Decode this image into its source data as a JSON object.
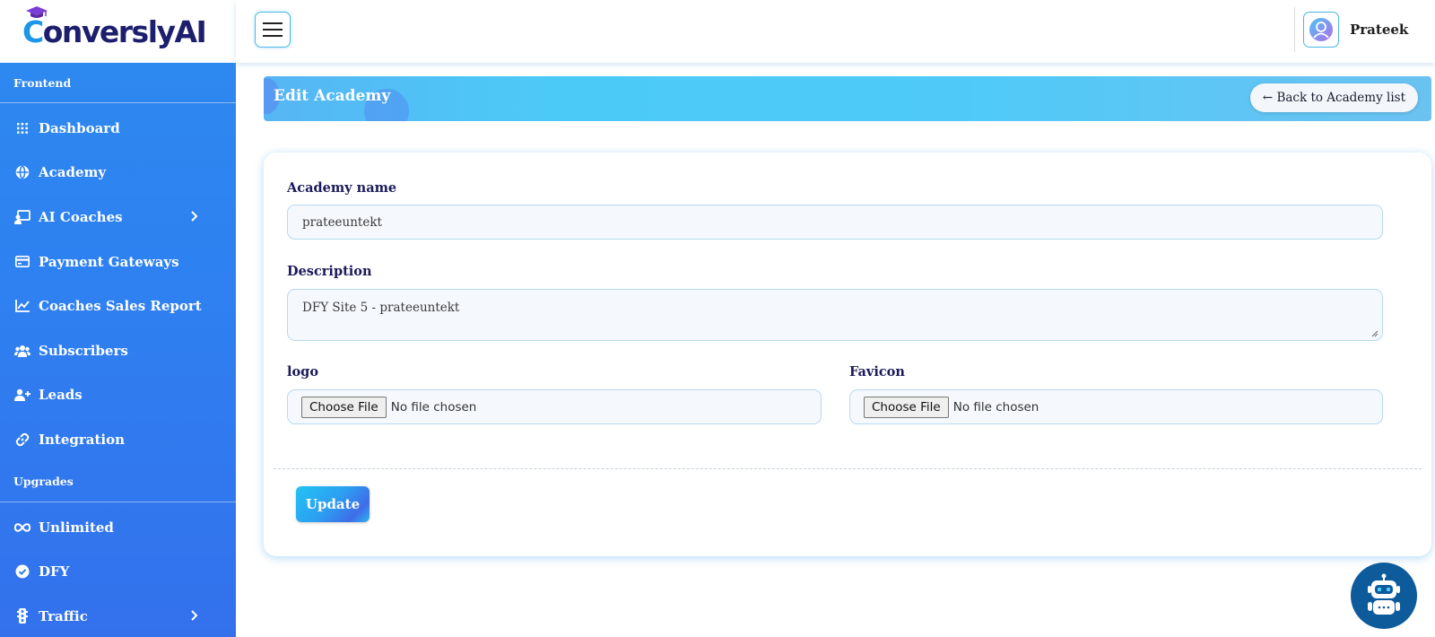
{
  "brand": {
    "logo_prefix": "C",
    "logo_text": "onverslyAI"
  },
  "sidebar": {
    "section1": "Frontend",
    "items": [
      {
        "label": "Dashboard",
        "icon": "grid-icon"
      },
      {
        "label": "Academy",
        "icon": "globe-icon"
      },
      {
        "label": "AI Coaches",
        "icon": "chalkboard-icon",
        "has_submenu": true
      },
      {
        "label": "Payment Gateways",
        "icon": "credit-card-icon"
      },
      {
        "label": "Coaches Sales Report",
        "icon": "chart-line-icon"
      },
      {
        "label": "Subscribers",
        "icon": "users-icon"
      },
      {
        "label": "Leads",
        "icon": "user-plus-icon"
      },
      {
        "label": "Integration",
        "icon": "link-icon"
      }
    ],
    "section2": "Upgrades",
    "upgrade_items": [
      {
        "label": "Unlimited",
        "icon": "infinity-icon"
      },
      {
        "label": "DFY",
        "icon": "check-circle-icon"
      },
      {
        "label": "Traffic",
        "icon": "traffic-light-icon",
        "has_submenu": true
      }
    ]
  },
  "topbar": {
    "user_name": "Prateek"
  },
  "header": {
    "title": "Edit Academy",
    "back_label": "← Back to Academy list"
  },
  "form": {
    "name_label": "Academy name",
    "name_value": "prateeuntekt",
    "description_label": "Description",
    "description_value": "DFY Site 5 - prateeuntekt",
    "logo_label": "logo",
    "favicon_label": "Favicon",
    "file_button": "Choose File",
    "file_status": "No file chosen",
    "submit_label": "Update"
  },
  "colors": {
    "sidebar": "#2f7ff0",
    "header": "#4ccaf7",
    "accent": "#49b8e8",
    "label": "#1b1b5a"
  }
}
